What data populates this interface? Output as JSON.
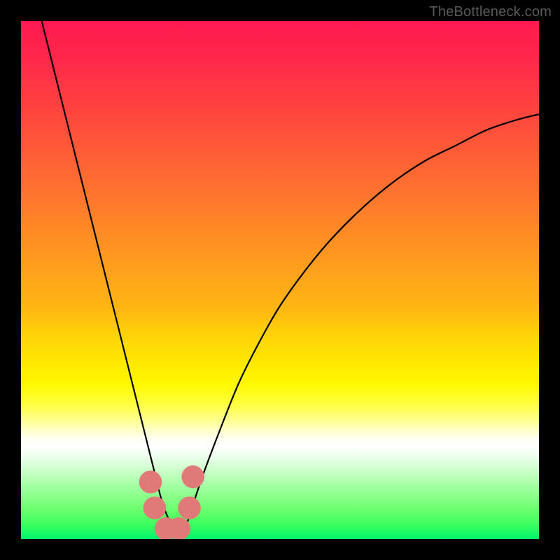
{
  "watermark": "TheBottleneck.com",
  "chart_data": {
    "type": "line",
    "title": "",
    "xlabel": "",
    "ylabel": "",
    "xlim": [
      0,
      100
    ],
    "ylim": [
      0,
      100
    ],
    "background_gradient": {
      "orientation": "vertical",
      "stops": [
        {
          "pos": 0,
          "color": "#ff1850"
        },
        {
          "pos": 50,
          "color": "#ffa01c"
        },
        {
          "pos": 70,
          "color": "#fff800"
        },
        {
          "pos": 82,
          "color": "#ffffff"
        },
        {
          "pos": 100,
          "color": "#00f068"
        }
      ]
    },
    "series": [
      {
        "name": "bottleneck-curve",
        "color": "#000000",
        "x": [
          4,
          6,
          8,
          10,
          12,
          14,
          16,
          18,
          20,
          22,
          24,
          25,
          26,
          27,
          28,
          29,
          30,
          31,
          32,
          33,
          35,
          38,
          42,
          46,
          50,
          55,
          60,
          66,
          72,
          78,
          84,
          90,
          96,
          100
        ],
        "values": [
          100,
          92,
          84,
          76,
          68,
          60,
          52,
          44,
          36,
          28,
          20,
          16,
          12,
          8,
          5,
          3,
          2,
          2,
          3,
          6,
          12,
          20,
          30,
          38,
          45,
          52,
          58,
          64,
          69,
          73,
          76,
          79,
          81,
          82
        ]
      }
    ],
    "markers": [
      {
        "name": "marker-left-upper",
        "x": 25.0,
        "y": 11,
        "r": 2.2,
        "color": "#e07a78"
      },
      {
        "name": "marker-left-lower",
        "x": 25.8,
        "y": 6,
        "r": 2.2,
        "color": "#e07a78"
      },
      {
        "name": "marker-floor-left",
        "x": 28.0,
        "y": 2,
        "r": 2.2,
        "color": "#e07a78"
      },
      {
        "name": "marker-floor-right",
        "x": 30.5,
        "y": 2,
        "r": 2.2,
        "color": "#e07a78"
      },
      {
        "name": "marker-right-lower",
        "x": 32.5,
        "y": 6,
        "r": 2.2,
        "color": "#e07a78"
      },
      {
        "name": "marker-right-upper",
        "x": 33.2,
        "y": 12,
        "r": 2.2,
        "color": "#e07a78"
      }
    ]
  }
}
